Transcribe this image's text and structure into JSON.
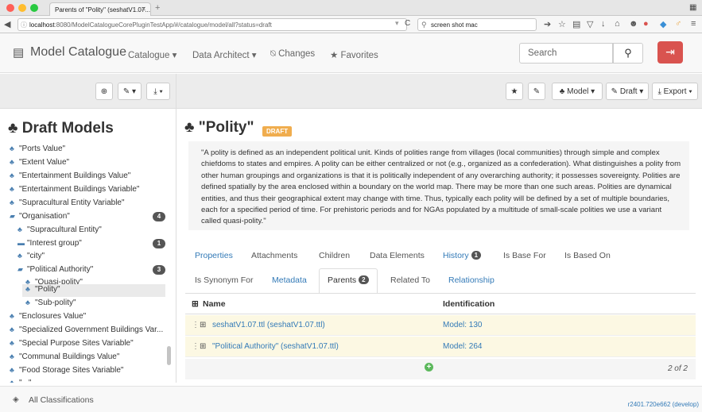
{
  "browser": {
    "tab_title": "Parents of \"Polity\" (seshatV1.07....",
    "url_host": "localhost",
    "url_rest": ":8080/ModelCatalogueCorePluginTestApp/#/catalogue/model/all?status=draft",
    "search_text": "screen shot mac"
  },
  "nav": {
    "brand": "Model Catalogue",
    "items": [
      "Catalogue",
      "Data Architect",
      "Changes",
      "Favorites"
    ],
    "search_placeholder": "Search"
  },
  "toolbar": {
    "model": "Model",
    "draft": "Draft",
    "export": "Export"
  },
  "sidebar": {
    "title": "Draft Models",
    "items": [
      {
        "label": "\"Ports Value\""
      },
      {
        "label": "\"Extent Value\""
      },
      {
        "label": "\"Entertainment Buildings Value\""
      },
      {
        "label": "\"Entertainment Buildings Variable\""
      },
      {
        "label": "\"Supracultural Entity Variable\""
      },
      {
        "label": "\"Organisation\"",
        "count": "4"
      },
      {
        "label": "\"Supracultural Entity\""
      },
      {
        "label": "\"Interest group\"",
        "count": "1"
      },
      {
        "label": "\"city\""
      },
      {
        "label": "\"Political Authority\"",
        "count": "3"
      },
      {
        "label": "\"Quasi-polity\""
      },
      {
        "label": "\"Polity\""
      },
      {
        "label": "\"Sub-polity\""
      },
      {
        "label": "\"Enclosures Value\""
      },
      {
        "label": "\"Specialized Government Buildings Var..."
      },
      {
        "label": "\"Special Purpose Sites Variable\""
      },
      {
        "label": "\"Communal Buildings Value\""
      },
      {
        "label": "\"Food Storage Sites Variable\""
      },
      {
        "label": "\"...\""
      }
    ]
  },
  "main": {
    "title": "\"Polity\"",
    "status_badge": "DRAFT",
    "description": "\"A polity is defined as an independent political unit. Kinds of polities range from villages (local communities) through simple and complex chiefdoms to states and empires. A polity can be either centralized or not (e.g., organized as a confederation). What distinguishes a polity from other human groupings and organizations is that it is politically independent of any overarching authority; it possesses sovereignty. Polities are defined spatially by the area enclosed within a boundary on the world map. There may be more than one such areas. Polities are dynamical entities, and thus their geographical extent may change with time. Thus, typically each polity will be defined by a set of multiple boundaries, each for a specified period of time. For prehistoric periods and for NGAs populated by a multitude of small-scale polities we use a variant called quasi-polity.\"",
    "tabs_row1": {
      "properties": "Properties",
      "attachments": "Attachments",
      "children": "Children",
      "data_elements": "Data Elements",
      "history": "History",
      "history_count": "1",
      "is_base_for": "Is Base For",
      "is_based_on": "Is Based On"
    },
    "tabs_row2": {
      "is_synonym_for": "Is Synonym For",
      "metadata": "Metadata",
      "parents": "Parents",
      "parents_count": "2",
      "related_to": "Related To",
      "relationship": "Relationship"
    },
    "table": {
      "col_name": "Name",
      "col_identification": "Identification",
      "rows": [
        {
          "name": "seshatV1.07.ttl (seshatV1.07.ttl)",
          "id": "Model: 130"
        },
        {
          "name": "\"Political Authority\" (seshatV1.07.ttl)",
          "id": "Model: 264"
        }
      ],
      "pagination": "2 of 2"
    }
  },
  "footer": {
    "classifications": "All Classifications",
    "version": "r2401.720e662 (develop)"
  }
}
